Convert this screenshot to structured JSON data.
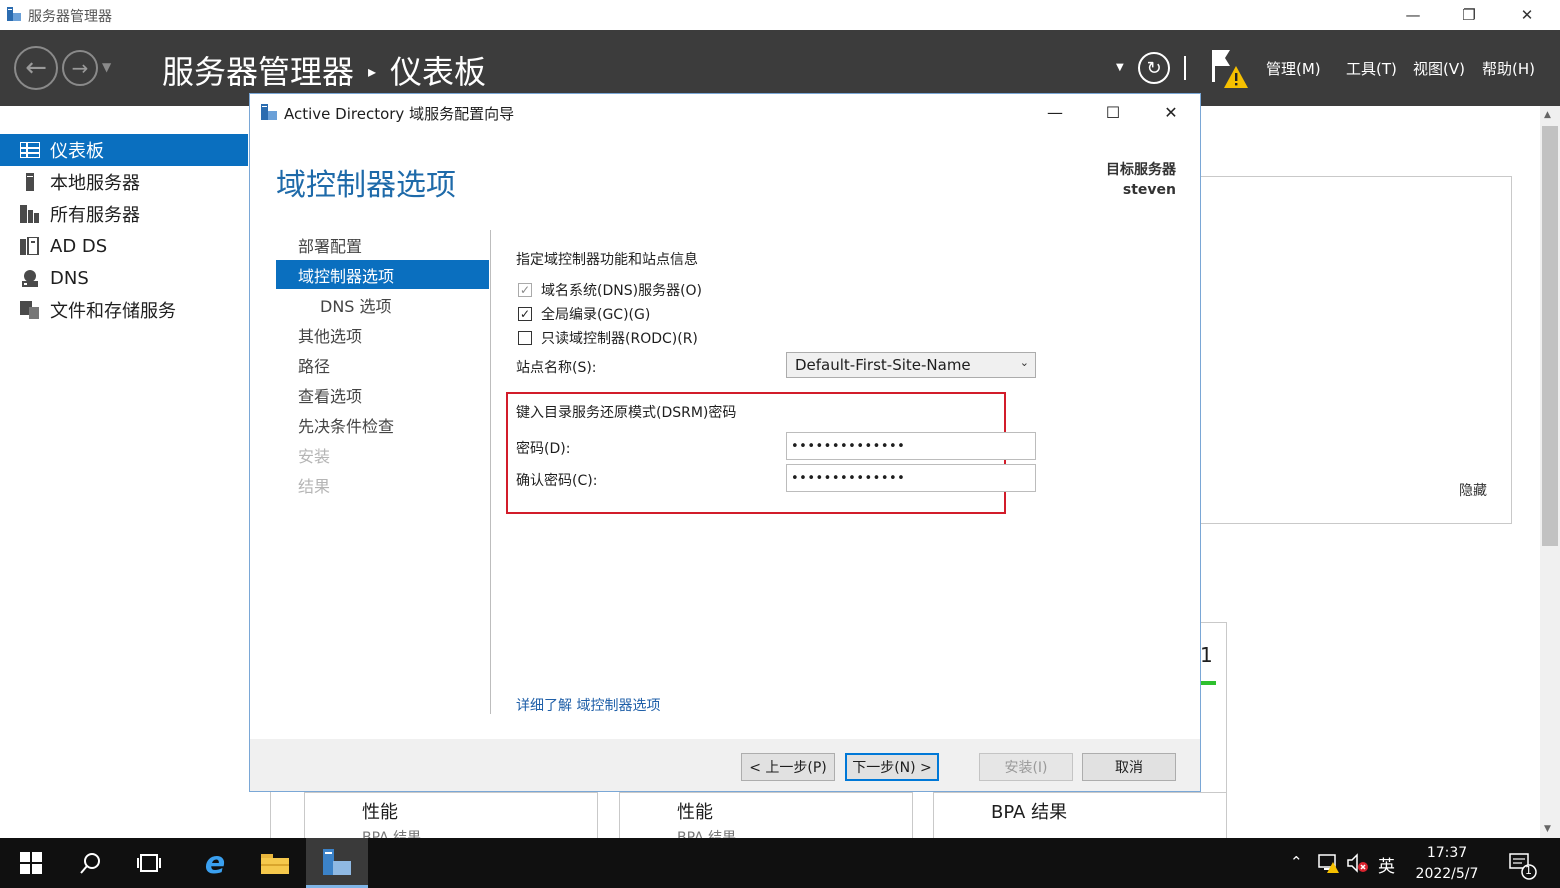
{
  "window": {
    "title": "服务器管理器",
    "controls": [
      "minimize",
      "restore",
      "close"
    ]
  },
  "header": {
    "app_name": "服务器管理器",
    "current_page": "仪表板",
    "menu": [
      "管理(M)",
      "工具(T)",
      "视图(V)",
      "帮助(H)"
    ],
    "icons": [
      "back-icon",
      "forward-icon",
      "refresh-icon",
      "flag-warning-icon"
    ]
  },
  "sidebar": {
    "items": [
      {
        "label": "仪表板",
        "icon": "dashboard-icon",
        "active": true
      },
      {
        "label": "本地服务器",
        "icon": "local-server-icon"
      },
      {
        "label": "所有服务器",
        "icon": "all-servers-icon"
      },
      {
        "label": "AD DS",
        "icon": "adds-icon"
      },
      {
        "label": "DNS",
        "icon": "dns-icon"
      },
      {
        "label": "文件和存储服务",
        "icon": "file-storage-icon"
      }
    ]
  },
  "background": {
    "hide_link": "隐藏",
    "tile_number": "1",
    "tiles": [
      {
        "title": "性能",
        "sub": "BPA 结果"
      },
      {
        "title": "性能",
        "sub": "BPA 结果"
      },
      {
        "title": "BPA 结果"
      }
    ]
  },
  "dialog": {
    "title": "Active Directory 域服务配置向导",
    "heading": "域控制器选项",
    "target_label": "目标服务器",
    "target_name": "steven",
    "steps": [
      {
        "label": "部署配置",
        "state": "normal"
      },
      {
        "label": "域控制器选项",
        "state": "active"
      },
      {
        "label": "DNS 选项",
        "state": "sub"
      },
      {
        "label": "其他选项",
        "state": "normal"
      },
      {
        "label": "路径",
        "state": "normal"
      },
      {
        "label": "查看选项",
        "state": "normal"
      },
      {
        "label": "先决条件检查",
        "state": "normal"
      },
      {
        "label": "安装",
        "state": "disabled"
      },
      {
        "label": "结果",
        "state": "disabled"
      }
    ],
    "section_title": "指定域控制器功能和站点信息",
    "checkboxes": [
      {
        "label": "域名系统(DNS)服务器(O)",
        "checked": true,
        "disabled": true
      },
      {
        "label": "全局编录(GC)(G)",
        "checked": true,
        "disabled": false
      },
      {
        "label": "只读域控制器(RODC)(R)",
        "checked": false,
        "disabled": false
      }
    ],
    "site_label": "站点名称(S):",
    "site_value": "Default-First-Site-Name",
    "dsrm_title": "键入目录服务还原模式(DSRM)密码",
    "password_label": "密码(D):",
    "password_value": "••••••••••••••",
    "confirm_label": "确认密码(C):",
    "confirm_value": "••••••••••••••",
    "learn_more": "详细了解 域控制器选项",
    "buttons": {
      "back": "< 上一步(P)",
      "next": "下一步(N) >",
      "install": "安装(I)",
      "cancel": "取消"
    }
  },
  "taskbar": {
    "ime": "英",
    "time": "17:37",
    "date": "2022/5/7",
    "notification_count": "1"
  },
  "colors": {
    "accent": "#0a6fbf",
    "header_bg": "#3c3c3c",
    "heading_blue": "#1e6aa9",
    "highlight_red": "#d21c2a",
    "link": "#1f5fa8"
  }
}
